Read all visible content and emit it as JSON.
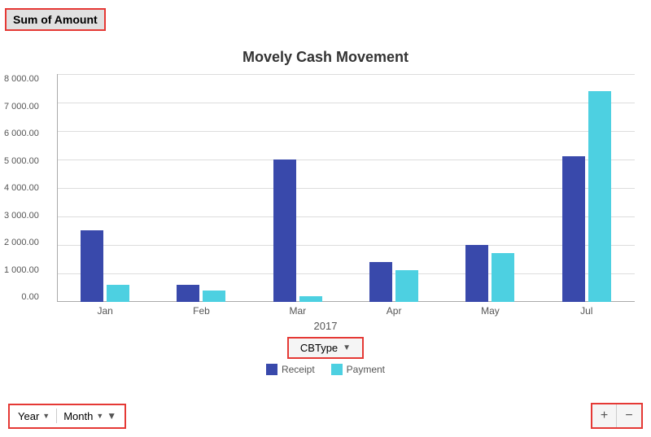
{
  "header": {
    "sum_of_amount_label": "Sum of Amount"
  },
  "chart": {
    "title": "Movely Cash Movement",
    "year": "2017",
    "y_axis_labels": [
      "8 000.00",
      "7 000.00",
      "6 000.00",
      "5 000.00",
      "4 000.00",
      "3 000.00",
      "2 000.00",
      "1 000.00",
      "0.00"
    ],
    "max_value": 8000,
    "bars": [
      {
        "month": "Jan",
        "receipt": 2500,
        "payment": 600
      },
      {
        "month": "Feb",
        "receipt": 600,
        "payment": 400
      },
      {
        "month": "Mar",
        "receipt": 5000,
        "payment": 200
      },
      {
        "month": "Apr",
        "receipt": 1400,
        "payment": 1100
      },
      {
        "month": "May",
        "receipt": 2000,
        "payment": 1700
      },
      {
        "month": "Jul",
        "receipt": 5100,
        "payment": 7400
      }
    ],
    "legend": {
      "receipt_label": "Receipt",
      "payment_label": "Payment",
      "receipt_color": "#3949ab",
      "payment_color": "#4dd0e1"
    },
    "filter": {
      "cbtype_label": "CBType"
    }
  },
  "bottom": {
    "year_label": "Year",
    "month_label": "Month",
    "zoom_plus": "+",
    "zoom_minus": "−"
  }
}
